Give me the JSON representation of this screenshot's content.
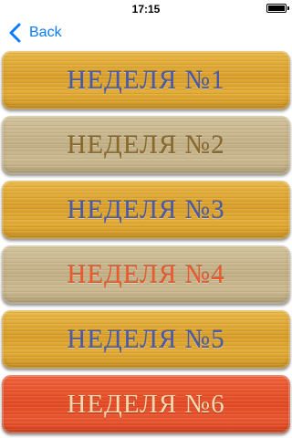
{
  "status_bar": {
    "time": "17:15",
    "battery_level": 1.0
  },
  "nav": {
    "back_label": "Back",
    "icon": "chevron-left-icon",
    "accent_color": "#0a7aff"
  },
  "weeks": [
    {
      "label": "НЕДЕЛЯ №1",
      "style": "gold",
      "text_color": "#4a5aa8"
    },
    {
      "label": "НЕДЕЛЯ №2",
      "style": "tan",
      "text_color": "#8a6a2a"
    },
    {
      "label": "НЕДЕЛЯ №3",
      "style": "gold",
      "text_color": "#4a5aa8"
    },
    {
      "label": "НЕДЕЛЯ №4",
      "style": "tan",
      "text_color": "#ea5a2c"
    },
    {
      "label": "НЕДЕЛЯ №5",
      "style": "gold",
      "text_color": "#4a5aa8"
    },
    {
      "label": "НЕДЕЛЯ №6",
      "style": "red",
      "text_color": "#f1d9b3"
    }
  ]
}
